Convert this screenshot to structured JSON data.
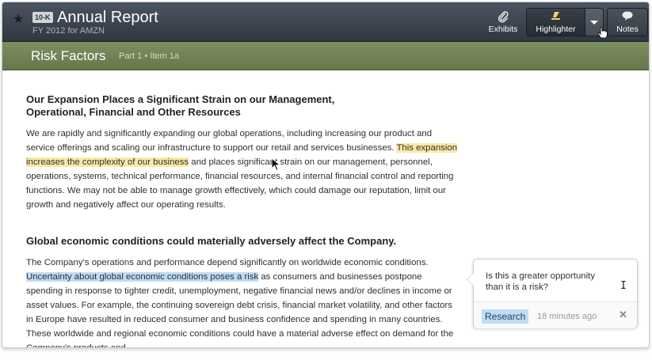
{
  "header": {
    "badge": "10-K",
    "title": "Annual Report",
    "subtitle": "FY 2012 for AMZN",
    "buttons": {
      "exhibits": "Exhibits",
      "highlighter": "Highlighter",
      "notes": "Notes"
    }
  },
  "section": {
    "title": "Risk Factors",
    "subtitle": "Part 1 • Item 1a"
  },
  "content": {
    "heading1": "Our Expansion Places a Significant Strain on our Management, Operational, Financial and Other Resources",
    "para1_before": "We are rapidly and significantly expanding our global operations, including increasing our product and service offerings and scaling our infrastructure to support our retail and services businesses. ",
    "para1_highlight": "This expansion increases the complexity of our business",
    "para1_after": " and places significant strain on our management, personnel, operations, systems, technical performance, financial resources, and internal financial control and reporting functions. We may not be able to manage growth effectively, which could damage our reputation, limit our growth and negatively affect our operating results.",
    "heading2": "Global economic conditions could materially adversely affect the Company.",
    "para2_before": "The Company’s operations and performance depend significantly on worldwide economic conditions. ",
    "para2_highlight": "Uncertainty about global economic conditions poses a risk",
    "para2_after": " as consumers and businesses postpone spending in response to tighter credit, unemployment, negative financial news and/or declines in income or asset values. For example, the continuing sovereign debt crisis, financial market volatility, and other factors in Europe have resulted in reduced consumer and business confidence and spending in many countries. These worldwide and regional economic conditions could have a material adverse effect on demand for the Company’s products and"
  },
  "note": {
    "text": "Is this a greater opportunity than it is a risk?",
    "tag": "Research",
    "time": "18 minutes ago",
    "close": "✕"
  },
  "colors": {
    "toolbar": "#3b444e",
    "section_bar": "#74855a",
    "highlight_yellow": "#fbe9a4",
    "highlight_blue": "#bfdcf4"
  },
  "icons": [
    "star-icon",
    "paperclip-icon",
    "highlighter-icon",
    "chevron-down-icon",
    "speech-bubble-icon",
    "close-icon",
    "text-cursor-icon"
  ]
}
